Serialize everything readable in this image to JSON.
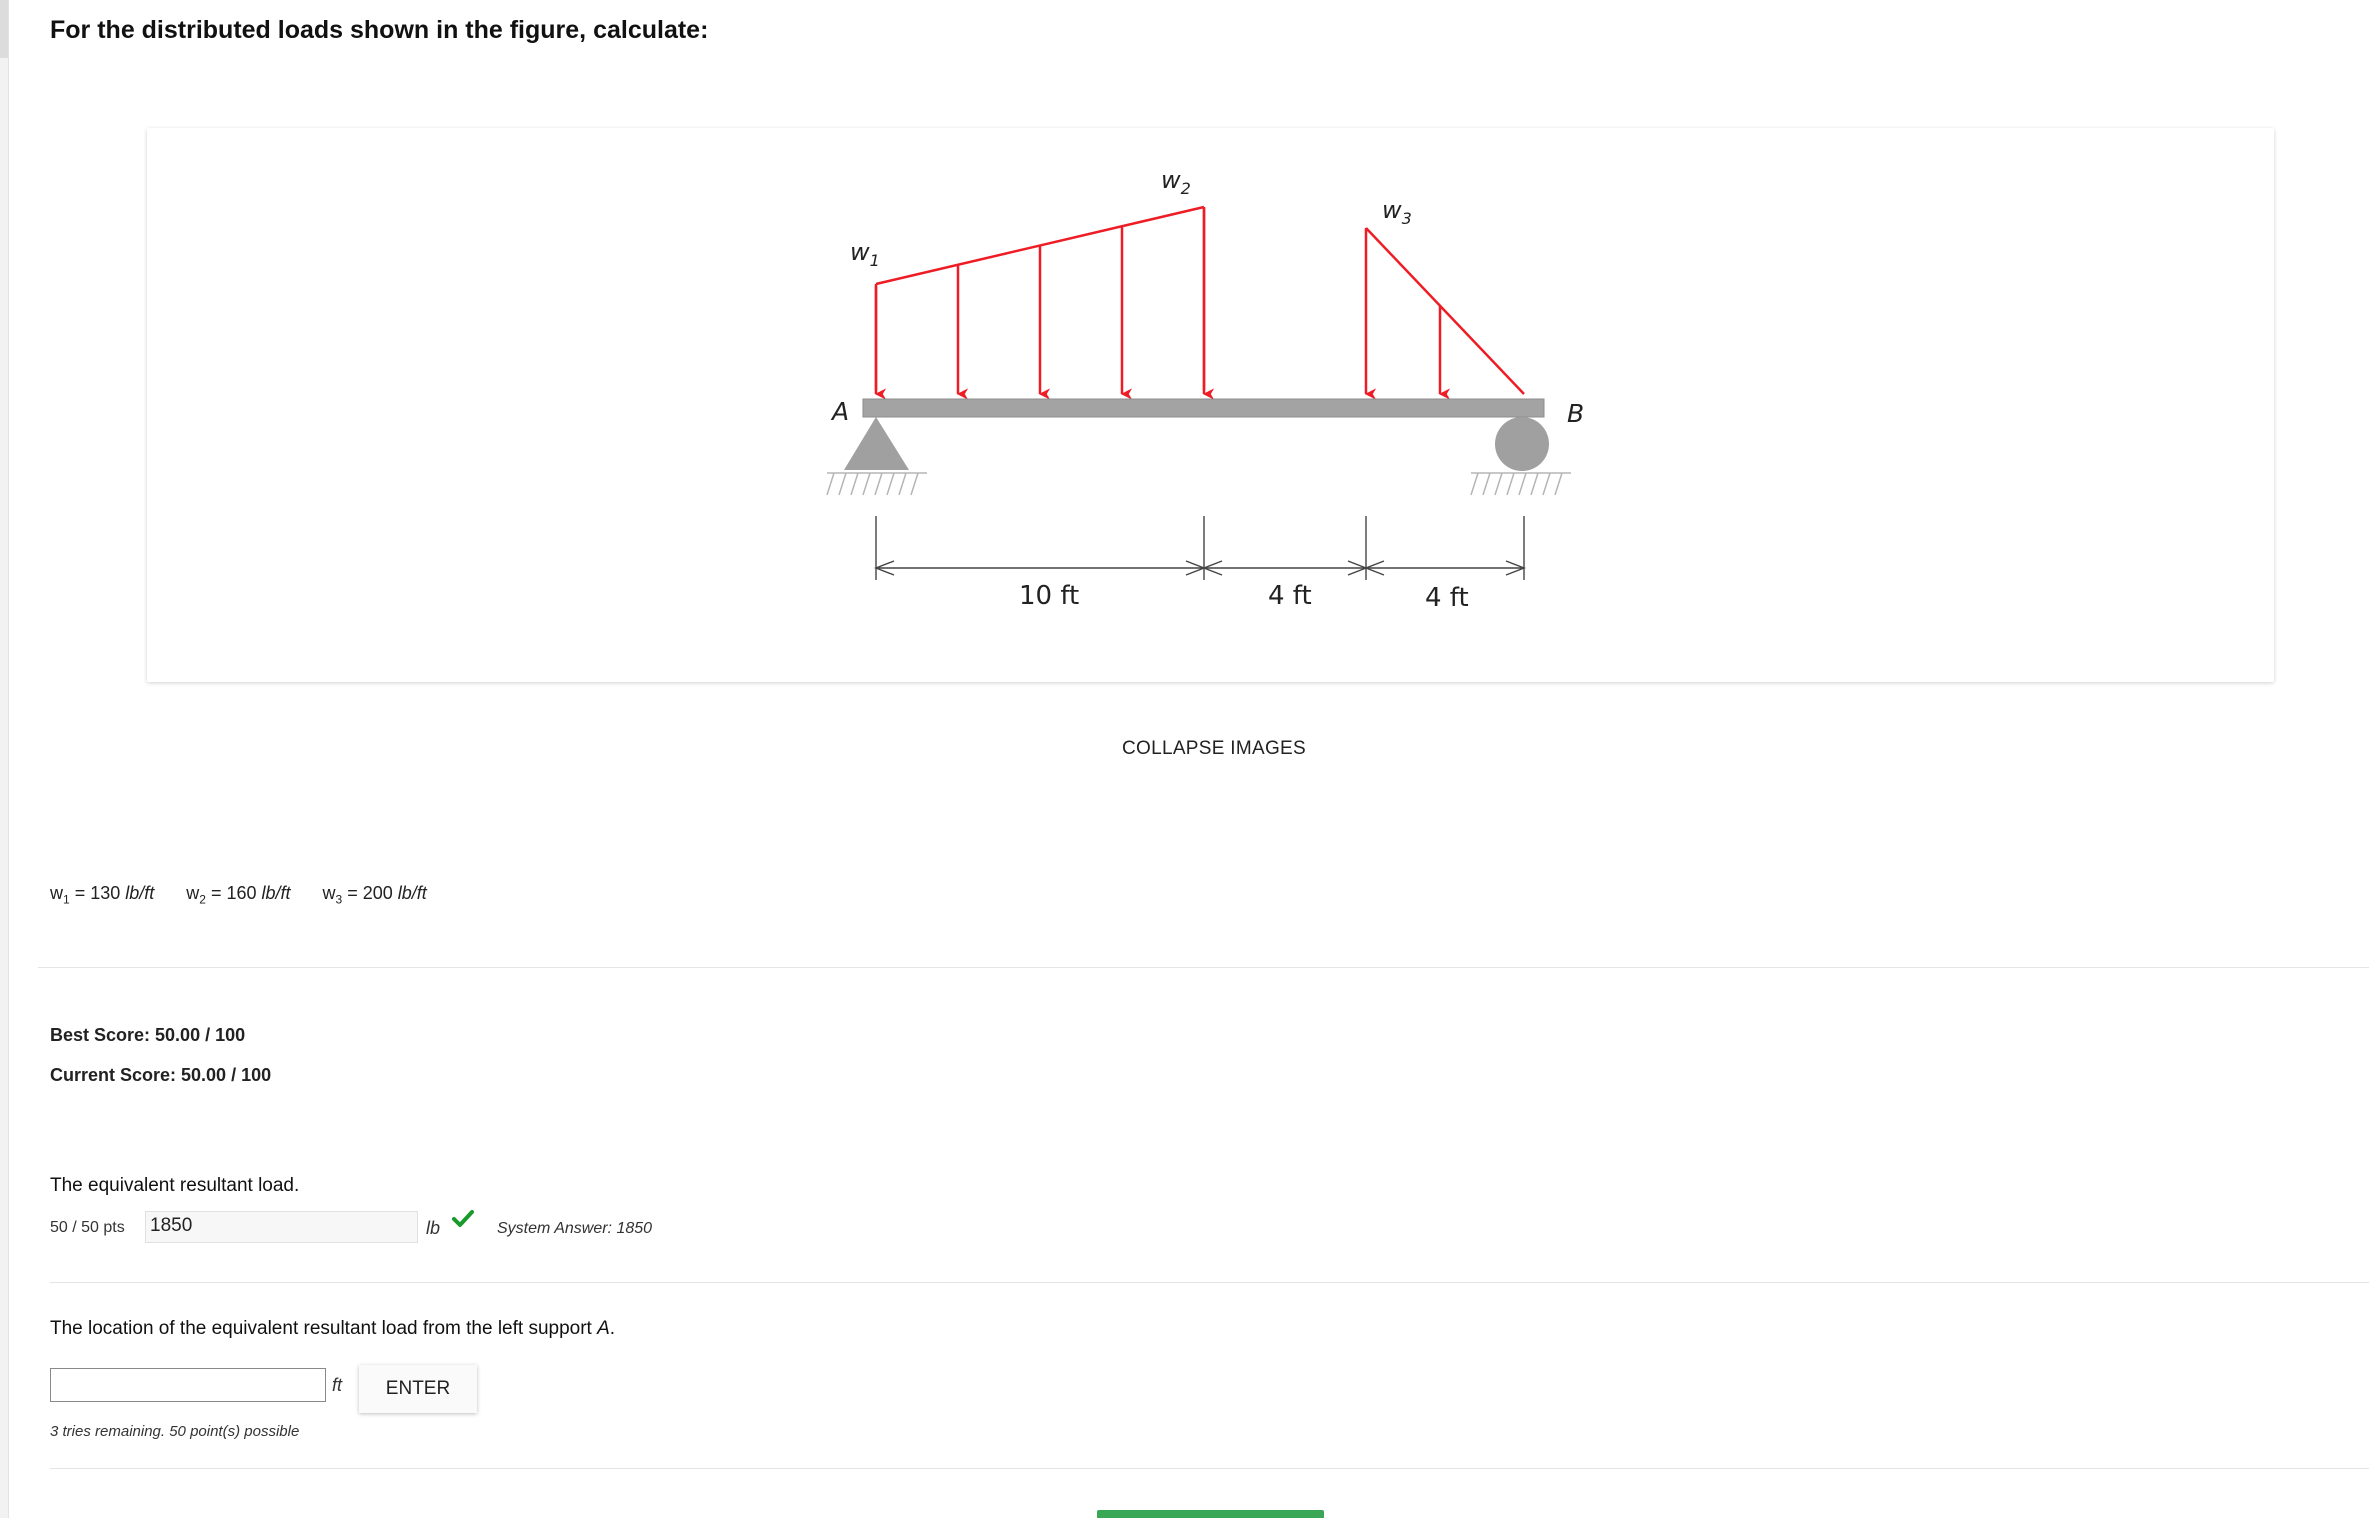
{
  "question": {
    "title": "For the distributed loads shown in the figure, calculate:"
  },
  "figure": {
    "labels": {
      "w1": "w",
      "w1_sub": "1",
      "w2": "w",
      "w2_sub": "2",
      "w3": "w",
      "w3_sub": "3",
      "A": "A",
      "B": "B"
    },
    "dimensions": [
      "10 ft",
      "4 ft",
      "4 ft"
    ],
    "colors": {
      "load": "#ee1c25",
      "beam": "#a3a3a3",
      "support": "#a0a0a0"
    }
  },
  "collapse_label": "COLLAPSE IMAGES",
  "variables": [
    {
      "name": "w",
      "sub": "1",
      "eq": " = 130 ",
      "unit": "lb/ft"
    },
    {
      "name": "w",
      "sub": "2",
      "eq": " = 160 ",
      "unit": "lb/ft"
    },
    {
      "name": "w",
      "sub": "3",
      "eq": " = 200 ",
      "unit": "lb/ft"
    }
  ],
  "scores": {
    "best": "Best Score: 50.00 / 100",
    "current": "Current Score: 50.00 / 100"
  },
  "part1": {
    "prompt": "The equivalent resultant load.",
    "points": "50 / 50 pts",
    "answer": "1850",
    "unit": "lb",
    "system_answer": "System Answer: 1850"
  },
  "part2": {
    "prompt_pre": "The location of the equivalent resultant load from the left support ",
    "prompt_var": "A",
    "prompt_post": ".",
    "value": "",
    "unit": "ft",
    "button": "ENTER",
    "tries": "3 tries remaining. 50 point(s) possible"
  },
  "accent": {
    "correct": "#1a9a2c",
    "submit_bar": "#3aa757"
  }
}
